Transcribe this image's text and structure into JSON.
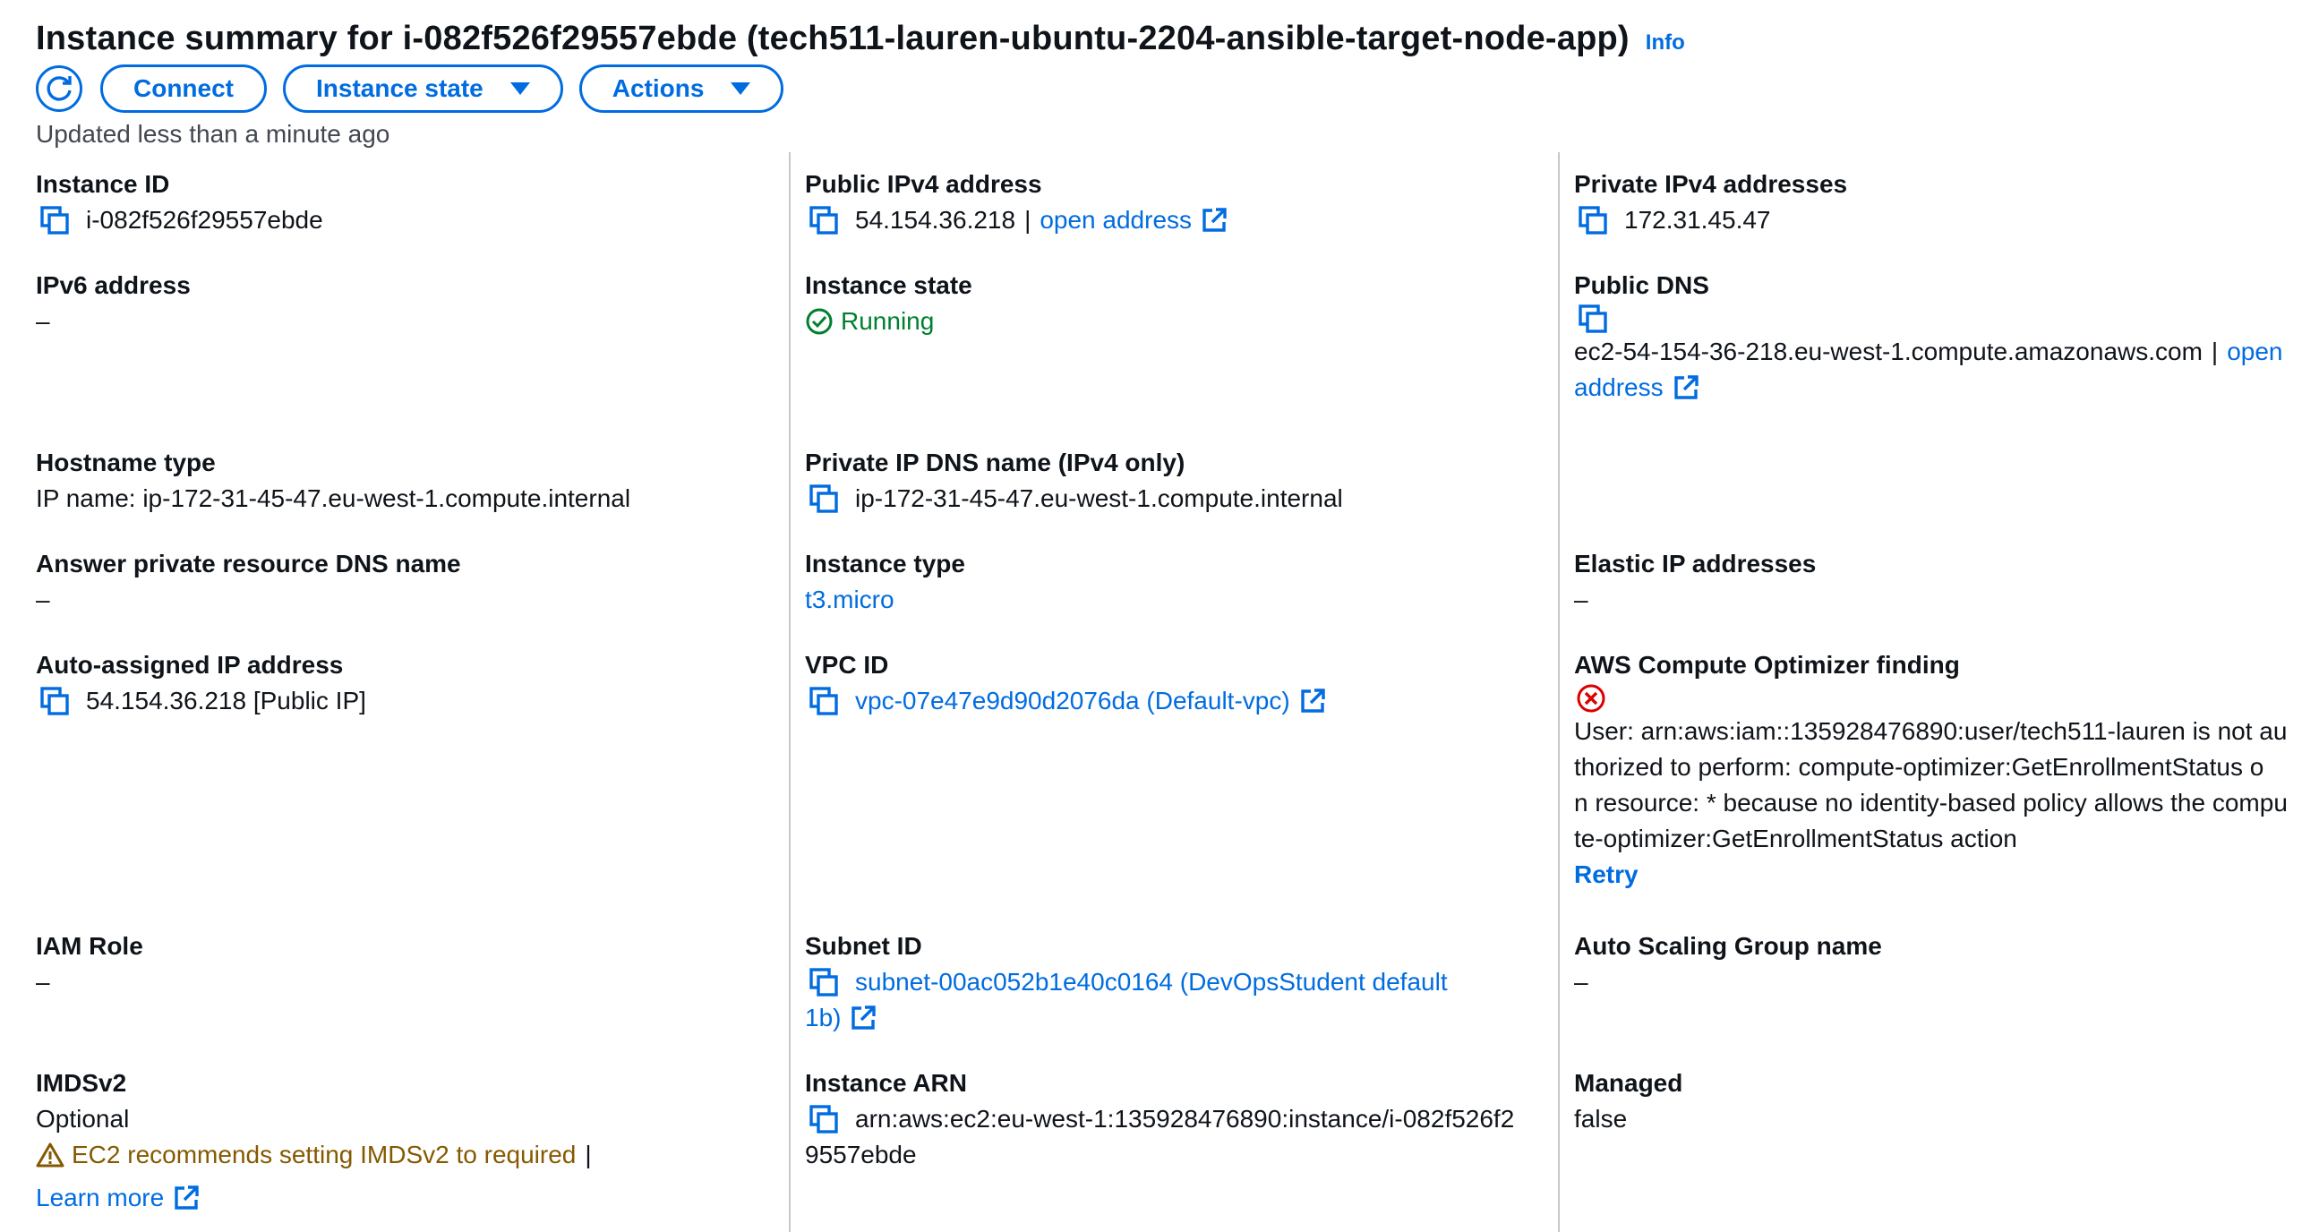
{
  "header": {
    "title": "Instance summary for i-082f526f29557ebde (tech511-lauren-ubuntu-2204-ansible-target-node-app)",
    "info": "Info",
    "buttons": {
      "connect": "Connect",
      "instance_state": "Instance state",
      "actions": "Actions"
    },
    "updated": "Updated less than a minute ago"
  },
  "col1": {
    "instance_id": {
      "label": "Instance ID",
      "value": "i-082f526f29557ebde"
    },
    "ipv6": {
      "label": "IPv6 address",
      "value": "–"
    },
    "hostname_type": {
      "label": "Hostname type",
      "value": "IP name: ip-172-31-45-47.eu-west-1.compute.internal"
    },
    "answer_dns": {
      "label": "Answer private resource DNS name",
      "value": "–"
    },
    "auto_ip": {
      "label": "Auto-assigned IP address",
      "value": "54.154.36.218 [Public IP]"
    },
    "iam_role": {
      "label": "IAM Role",
      "value": "–"
    },
    "imdsv2": {
      "label": "IMDSv2",
      "value": "Optional",
      "warning": "EC2 recommends setting IMDSv2 to required",
      "separator": "|",
      "learn_more": "Learn more"
    }
  },
  "col2": {
    "public_ipv4": {
      "label": "Public IPv4 address",
      "value": "54.154.36.218",
      "separator": "|",
      "link": "open address"
    },
    "instance_state": {
      "label": "Instance state",
      "value": "Running"
    },
    "private_dns": {
      "label": "Private IP DNS name (IPv4 only)",
      "value": "ip-172-31-45-47.eu-west-1.compute.internal"
    },
    "instance_type": {
      "label": "Instance type",
      "value": "t3.micro"
    },
    "vpc_id": {
      "label": "VPC ID",
      "value": "vpc-07e47e9d90d2076da (Default-vpc)"
    },
    "subnet_id": {
      "label": "Subnet ID",
      "value_line1": "subnet-00ac052b1e40c0164 (DevOpsStudent default",
      "value_line2": "1b)"
    },
    "instance_arn": {
      "label": "Instance ARN",
      "value_line1": "arn:aws:ec2:eu-west-1:135928476890:instance/i-082f526f2",
      "value_line2": "9557ebde"
    }
  },
  "col3": {
    "private_ipv4": {
      "label": "Private IPv4 addresses",
      "value": "172.31.45.47"
    },
    "public_dns": {
      "label": "Public DNS",
      "value": "ec2-54-154-36-218.eu-west-1.compute.amazonaws.com",
      "separator": "|",
      "link_part1": "open",
      "link_part2": "address"
    },
    "elastic_ip": {
      "label": "Elastic IP addresses",
      "value": "–"
    },
    "optimizer": {
      "label": "AWS Compute Optimizer finding",
      "line1": "User: arn:aws:iam::135928476890:user/tech511-lauren is not au",
      "line2": "thorized to perform: compute-optimizer:GetEnrollmentStatus o",
      "line3": "n resource: * because no identity-based policy allows the compu",
      "line4": "te-optimizer:GetEnrollmentStatus action",
      "retry": "Retry"
    },
    "asg_name": {
      "label": "Auto Scaling Group name",
      "value": "–"
    },
    "managed": {
      "label": "Managed",
      "value": "false"
    }
  },
  "colors": {
    "link": "#006ce0",
    "success": "#00802f",
    "warning": "#855900",
    "error": "#db0000",
    "divider": "#c6c6cd"
  }
}
